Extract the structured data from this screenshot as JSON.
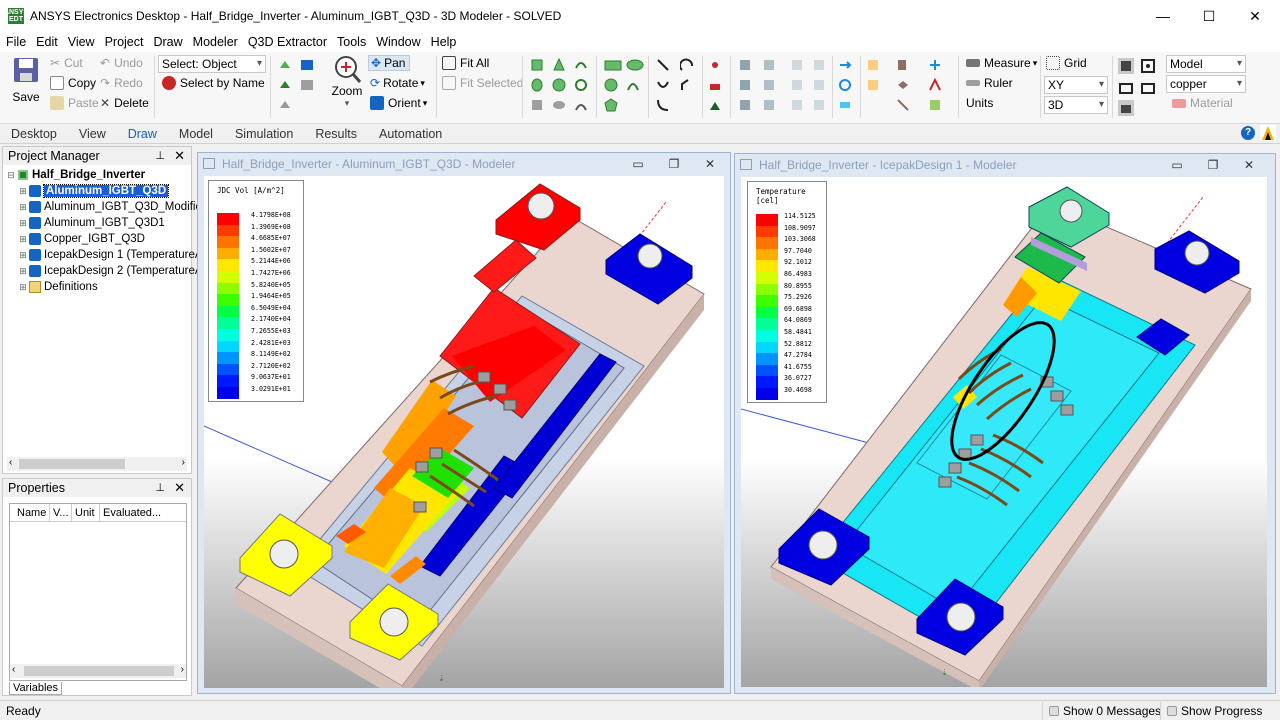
{
  "window": {
    "title": "ANSYS Electronics Desktop - Half_Bridge_Inverter - Aluminum_IGBT_Q3D - 3D Modeler - SOLVED",
    "logo_text": "ANSYS EDT",
    "minimize": "—",
    "maximize": "☐",
    "close": "✕"
  },
  "menu": [
    "File",
    "Edit",
    "View",
    "Project",
    "Draw",
    "Modeler",
    "Q3D Extractor",
    "Tools",
    "Window",
    "Help"
  ],
  "ribbon": {
    "save": "Save",
    "cut": "Cut",
    "copy": "Copy",
    "paste": "Paste",
    "undo": "Undo",
    "redo": "Redo",
    "delete": "Delete",
    "select_mode": "Select: Object",
    "select_by_name": "Select by Name",
    "zoom": "Zoom",
    "pan": "Pan",
    "rotate": "Rotate",
    "orient": "Orient",
    "fit_all": "Fit All",
    "fit_selected": "Fit Selected",
    "measure": "Measure",
    "ruler": "Ruler",
    "units": "Units",
    "grid": "Grid",
    "plane": "XY",
    "dimension": "3D",
    "model": "Model",
    "material_value": "copper",
    "material": "Material"
  },
  "ribbon_tabs": [
    "Desktop",
    "View",
    "Draw",
    "Model",
    "Simulation",
    "Results",
    "Automation"
  ],
  "active_tab": "Draw",
  "project_manager": {
    "title": "Project Manager",
    "pin": "📌",
    "close": "✕",
    "root": "Half_Bridge_Inverter",
    "items": [
      {
        "label": "Aluminum_IGBT_Q3D",
        "selected": true
      },
      {
        "label": "Aluminum_IGBT_Q3D_Modifie",
        "selected": false
      },
      {
        "label": "Aluminum_IGBT_Q3D1",
        "selected": false
      },
      {
        "label": "Copper_IGBT_Q3D",
        "selected": false
      },
      {
        "label": "IcepakDesign 1 (TemperatureA",
        "selected": false
      },
      {
        "label": "IcepakDesign 2 (TemperatureA",
        "selected": false
      },
      {
        "label": "Definitions",
        "selected": false
      }
    ]
  },
  "properties": {
    "title": "Properties",
    "columns": [
      "Name",
      "V...",
      "Unit",
      "Evaluated..."
    ],
    "tab": "Variables"
  },
  "left_window": {
    "title": "Half_Bridge_Inverter - Aluminum_IGBT_Q3D - Modeler",
    "legend_title": "JDC Vol [A/m^2]",
    "legend_values": [
      "4.1798E+08",
      "1.3969E+08",
      "4.6685E+07",
      "1.5602E+07",
      "5.2144E+06",
      "1.7427E+06",
      "5.8240E+05",
      "1.9464E+05",
      "6.5049E+04",
      "2.1740E+04",
      "7.2655E+03",
      "2.4281E+03",
      "8.1149E+02",
      "2.7120E+02",
      "9.0637E+01",
      "3.0291E+01"
    ],
    "legend_colors": [
      "#ff0000",
      "#ff3a00",
      "#ff7400",
      "#ffae00",
      "#ffe800",
      "#d4ff00",
      "#8cff00",
      "#3cff00",
      "#00ff46",
      "#00ff96",
      "#00ffe0",
      "#00d6ff",
      "#0094ff",
      "#0052ff",
      "#0018ff",
      "#0000e8"
    ]
  },
  "right_window": {
    "title": "Half_Bridge_Inverter - IcepakDesign 1 - Modeler",
    "legend_title": "Temperature\n[cel]",
    "legend_values": [
      "114.5125",
      "108.9097",
      "103.3068",
      "97.7040",
      "92.1012",
      "86.4983",
      "80.8955",
      "75.2926",
      "69.6898",
      "64.0869",
      "58.4841",
      "52.8812",
      "47.2784",
      "41.6755",
      "36.0727",
      "30.4698"
    ],
    "legend_colors": [
      "#ff0000",
      "#ff3a00",
      "#ff7400",
      "#ffae00",
      "#ffe800",
      "#d4ff00",
      "#8cff00",
      "#3cff00",
      "#00ff46",
      "#00ff96",
      "#00ffe0",
      "#00d6ff",
      "#0094ff",
      "#0052ff",
      "#0018ff",
      "#0000e8"
    ]
  },
  "status": {
    "ready": "Ready",
    "messages": "Show 0 Messages",
    "progress": "Show Progress"
  }
}
